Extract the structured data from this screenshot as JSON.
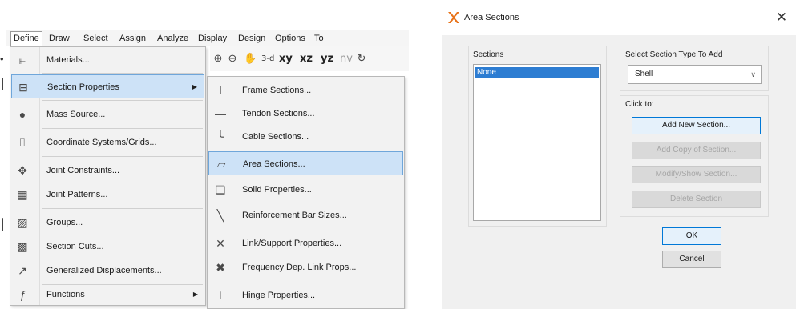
{
  "menubar": {
    "items": [
      "Define",
      "Draw",
      "Select",
      "Assign",
      "Analyze",
      "Display",
      "Design",
      "Options",
      "To"
    ]
  },
  "toolbar": {
    "view_3d": "3-d",
    "view_xy": "xy",
    "view_xz": "xz",
    "view_yz": "yz",
    "view_nv": "nv"
  },
  "define_menu": {
    "items": [
      {
        "label": "Materials...",
        "icon": "materials-icon"
      },
      {
        "label": "Section Properties",
        "icon": "section-properties-icon"
      },
      {
        "label": "Mass Source...",
        "icon": "mass-source-icon"
      },
      {
        "label": "Coordinate Systems/Grids...",
        "icon": "grid-icon"
      },
      {
        "label": "Joint Constraints...",
        "icon": "joint-constraints-icon"
      },
      {
        "label": "Joint Patterns...",
        "icon": "joint-patterns-icon"
      },
      {
        "label": "Groups...",
        "icon": "groups-icon"
      },
      {
        "label": "Section Cuts...",
        "icon": "section-cuts-icon"
      },
      {
        "label": "Generalized Displacements...",
        "icon": "displacements-icon"
      },
      {
        "label": "Functions",
        "icon": "functions-icon"
      }
    ]
  },
  "section_menu": {
    "items": [
      {
        "label": "Frame Sections...",
        "icon": "frame-section-icon"
      },
      {
        "label": "Tendon Sections...",
        "icon": "tendon-section-icon"
      },
      {
        "label": "Cable Sections...",
        "icon": "cable-section-icon"
      },
      {
        "label": "Area Sections...",
        "icon": "area-section-icon"
      },
      {
        "label": "Solid Properties...",
        "icon": "solid-properties-icon"
      },
      {
        "label": "Reinforcement Bar Sizes...",
        "icon": "rebar-icon"
      },
      {
        "label": "Link/Support Properties...",
        "icon": "link-support-icon"
      },
      {
        "label": "Frequency Dep. Link Props...",
        "icon": "frequency-link-icon"
      },
      {
        "label": "Hinge Properties...",
        "icon": "hinge-icon"
      }
    ]
  },
  "dialog": {
    "title": "Area Sections",
    "sections_label": "Sections",
    "sections_list": [
      "None"
    ],
    "type_label": "Select Section Type To Add",
    "type_value": "Shell",
    "click_to_label": "Click to:",
    "buttons": {
      "add_new": "Add New Section...",
      "add_copy": "Add Copy of Section...",
      "modify_show": "Modify/Show Section...",
      "delete": "Delete Section",
      "ok": "OK",
      "cancel": "Cancel"
    }
  },
  "colors": {
    "highlight": "#cde2f7",
    "highlight_border": "#6fa6da",
    "list_selection": "#2d7dd2",
    "title_icon": "#e8731a"
  }
}
